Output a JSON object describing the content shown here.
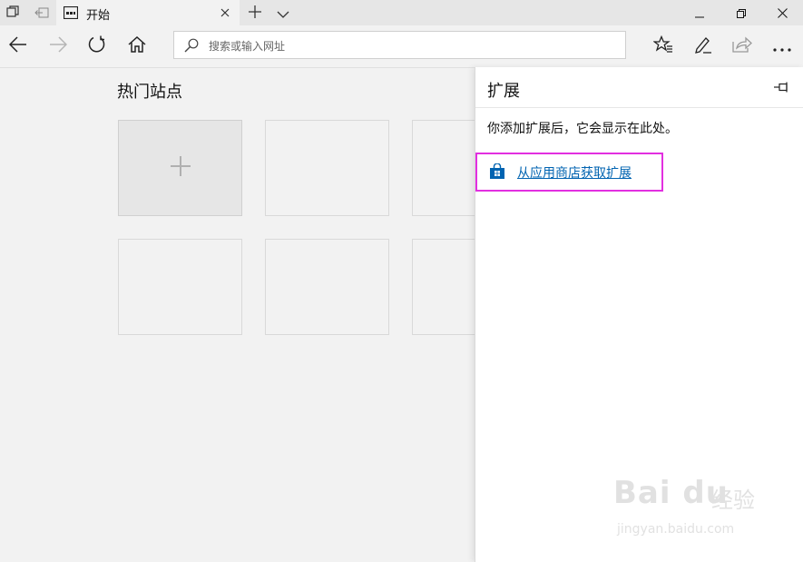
{
  "tab": {
    "title": "开始"
  },
  "address": {
    "placeholder": "搜索或输入网址"
  },
  "content": {
    "top_sites_title": "热门站点"
  },
  "extensions_pane": {
    "title": "扩展",
    "description": "你添加扩展后，它会显示在此处。",
    "store_link": "从应用商店获取扩展",
    "link_color": "#0063b1",
    "highlight_color": "#e22fe0"
  },
  "watermark": {
    "brand": "Bai du",
    "cn": "经验",
    "url": "jingyan.baidu.com"
  },
  "icons": {
    "tab_preview": "tab-preview-icon",
    "set_aside": "set-aside-tabs-icon",
    "page": "page-icon",
    "close": "close-icon",
    "new_tab": "plus-icon",
    "tab_list": "chevron-down-icon",
    "minimize": "minimize-icon",
    "restore": "restore-icon",
    "back": "back-arrow-icon",
    "forward": "forward-arrow-icon",
    "refresh": "refresh-icon",
    "home": "home-icon",
    "search": "search-icon",
    "favorites": "favorites-star-icon",
    "notes": "pen-icon",
    "share": "share-icon",
    "more": "more-icon",
    "pin": "pin-icon",
    "store": "store-bag-icon",
    "add": "plus-icon"
  }
}
